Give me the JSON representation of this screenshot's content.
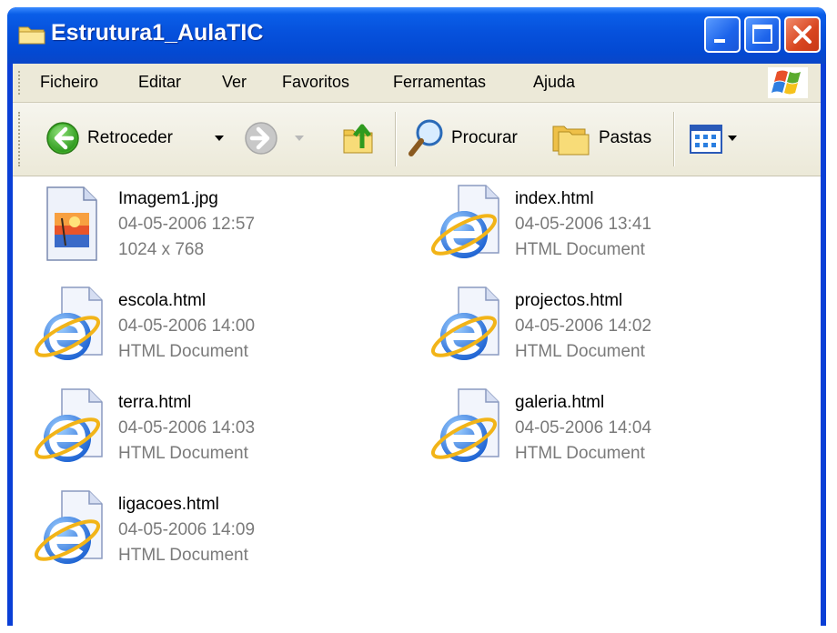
{
  "window": {
    "title": "Estrutura1_AulaTIC",
    "icon": "folder-icon",
    "controls": [
      "minimize-icon",
      "maximize-icon",
      "close-icon"
    ],
    "accent_color": "#0a5ee8"
  },
  "menubar": {
    "items": [
      "Ficheiro",
      "Editar",
      "Ver",
      "Favoritos",
      "Ferramentas",
      "Ajuda"
    ],
    "logo": "windows-logo-icon"
  },
  "toolbar": {
    "back_label": "Retroceder",
    "search_label": "Procurar",
    "folders_label": "Pastas",
    "icons": [
      "back-arrow-icon",
      "forward-arrow-icon",
      "up-folder-icon",
      "search-icon",
      "folders-icon",
      "views-icon"
    ]
  },
  "files": [
    {
      "name": "Imagem1.jpg",
      "date": "04-05-2006 12:57",
      "detail": "1024 x 768",
      "icon": "jpeg-image-icon"
    },
    {
      "name": "index.html",
      "date": "04-05-2006 13:41",
      "detail": "HTML Document",
      "icon": "ie-html-icon"
    },
    {
      "name": "escola.html",
      "date": "04-05-2006 14:00",
      "detail": "HTML Document",
      "icon": "ie-html-icon"
    },
    {
      "name": "projectos.html",
      "date": "04-05-2006 14:02",
      "detail": "HTML Document",
      "icon": "ie-html-icon"
    },
    {
      "name": "terra.html",
      "date": "04-05-2006 14:03",
      "detail": "HTML Document",
      "icon": "ie-html-icon"
    },
    {
      "name": "galeria.html",
      "date": "04-05-2006 14:04",
      "detail": "HTML Document",
      "icon": "ie-html-icon"
    },
    {
      "name": "ligacoes.html",
      "date": "04-05-2006 14:09",
      "detail": "HTML Document",
      "icon": "ie-html-icon"
    }
  ]
}
